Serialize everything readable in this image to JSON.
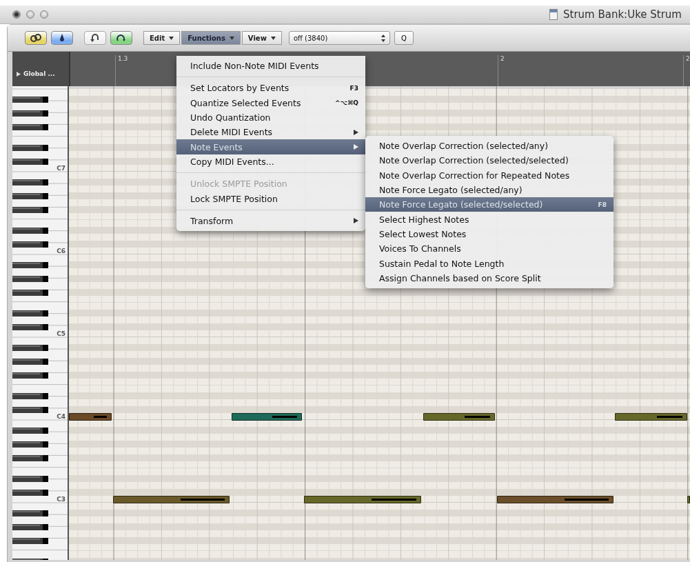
{
  "window": {
    "title": "Strum Bank:Uke Strum"
  },
  "toolbar": {
    "buttons": [
      {
        "kind": "link",
        "on": true,
        "color": "#e6d567"
      },
      {
        "kind": "midi",
        "on": true,
        "color": "#7eaef0"
      },
      {
        "kind": "undo",
        "on": false
      },
      {
        "kind": "loop",
        "on": true,
        "color": "#86d583"
      }
    ],
    "menus": [
      {
        "label": "Edit",
        "selected": false
      },
      {
        "label": "Functions",
        "selected": true
      },
      {
        "label": "View",
        "selected": false
      }
    ],
    "quantize": {
      "value": "off (3840)"
    },
    "q_button": "Q"
  },
  "global_tracks": {
    "label": "Global ...",
    "expanded": false
  },
  "ruler": {
    "marks": [
      "1.3",
      "2",
      "2"
    ]
  },
  "keyboard": {
    "octaves": [
      {
        "label": "C7"
      },
      {
        "label": "C6"
      },
      {
        "label": "C5"
      },
      {
        "label": "C4",
        "notes": [
          {
            "color": "#6b4a28"
          },
          {
            "color": "#1e6a58"
          },
          {
            "color": "#66682a"
          },
          {
            "color": "#66682a"
          }
        ]
      },
      {
        "label": "C3",
        "notes": [
          {
            "color": "#6a5a2a"
          },
          {
            "color": "#66682a"
          },
          {
            "color": "#6b4f2a"
          },
          {
            "color": "#66682a"
          }
        ]
      }
    ]
  },
  "functions_menu": {
    "items": [
      {
        "kind": "item",
        "label": "Include Non-Note MIDI Events",
        "submenu": false,
        "disabled": false,
        "selected": false
      },
      {
        "kind": "separator"
      },
      {
        "kind": "item",
        "label": "Set Locators by Events",
        "shortcut": "F3",
        "submenu": false,
        "disabled": false,
        "selected": false
      },
      {
        "kind": "item",
        "label": "Quantize Selected Events",
        "shortcut": "^⌥⌘Q",
        "submenu": false,
        "disabled": false,
        "selected": false
      },
      {
        "kind": "item",
        "label": "Undo Quantization",
        "submenu": false,
        "disabled": false,
        "selected": false
      },
      {
        "kind": "item",
        "label": "Delete MIDI Events",
        "submenu": true,
        "disabled": false,
        "selected": false
      },
      {
        "kind": "item",
        "label": "Note Events",
        "submenu": true,
        "disabled": false,
        "selected": true
      },
      {
        "kind": "item",
        "label": "Copy MIDI Events...",
        "submenu": false,
        "disabled": false,
        "selected": false
      },
      {
        "kind": "separator"
      },
      {
        "kind": "item",
        "label": "Unlock SMPTE Position",
        "submenu": false,
        "disabled": true,
        "selected": false
      },
      {
        "kind": "item",
        "label": "Lock SMPTE Position",
        "submenu": false,
        "disabled": false,
        "selected": false
      },
      {
        "kind": "separator"
      },
      {
        "kind": "item",
        "label": "Transform",
        "submenu": true,
        "disabled": false,
        "selected": false
      }
    ]
  },
  "note_events_menu": {
    "items": [
      {
        "kind": "item",
        "label": "Note Overlap Correction (selected/any)",
        "disabled": false,
        "selected": false
      },
      {
        "kind": "item",
        "label": "Note Overlap Correction (selected/selected)",
        "disabled": false,
        "selected": false
      },
      {
        "kind": "item",
        "label": "Note Overlap Correction for Repeated Notes",
        "disabled": false,
        "selected": false
      },
      {
        "kind": "item",
        "label": "Note Force Legato (selected/any)",
        "disabled": false,
        "selected": false
      },
      {
        "kind": "item",
        "label": "Note Force Legato (selected/selected)",
        "shortcut": "F8",
        "disabled": false,
        "selected": true
      },
      {
        "kind": "item",
        "label": "Select Highest Notes",
        "disabled": false,
        "selected": false
      },
      {
        "kind": "item",
        "label": "Select Lowest Notes",
        "disabled": false,
        "selected": false
      },
      {
        "kind": "item",
        "label": "Voices To Channels",
        "disabled": false,
        "selected": false
      },
      {
        "kind": "item",
        "label": "Sustain Pedal to Note Length",
        "disabled": false,
        "selected": false
      },
      {
        "kind": "item",
        "label": "Assign Channels based on Score Split",
        "disabled": false,
        "selected": false
      }
    ]
  }
}
